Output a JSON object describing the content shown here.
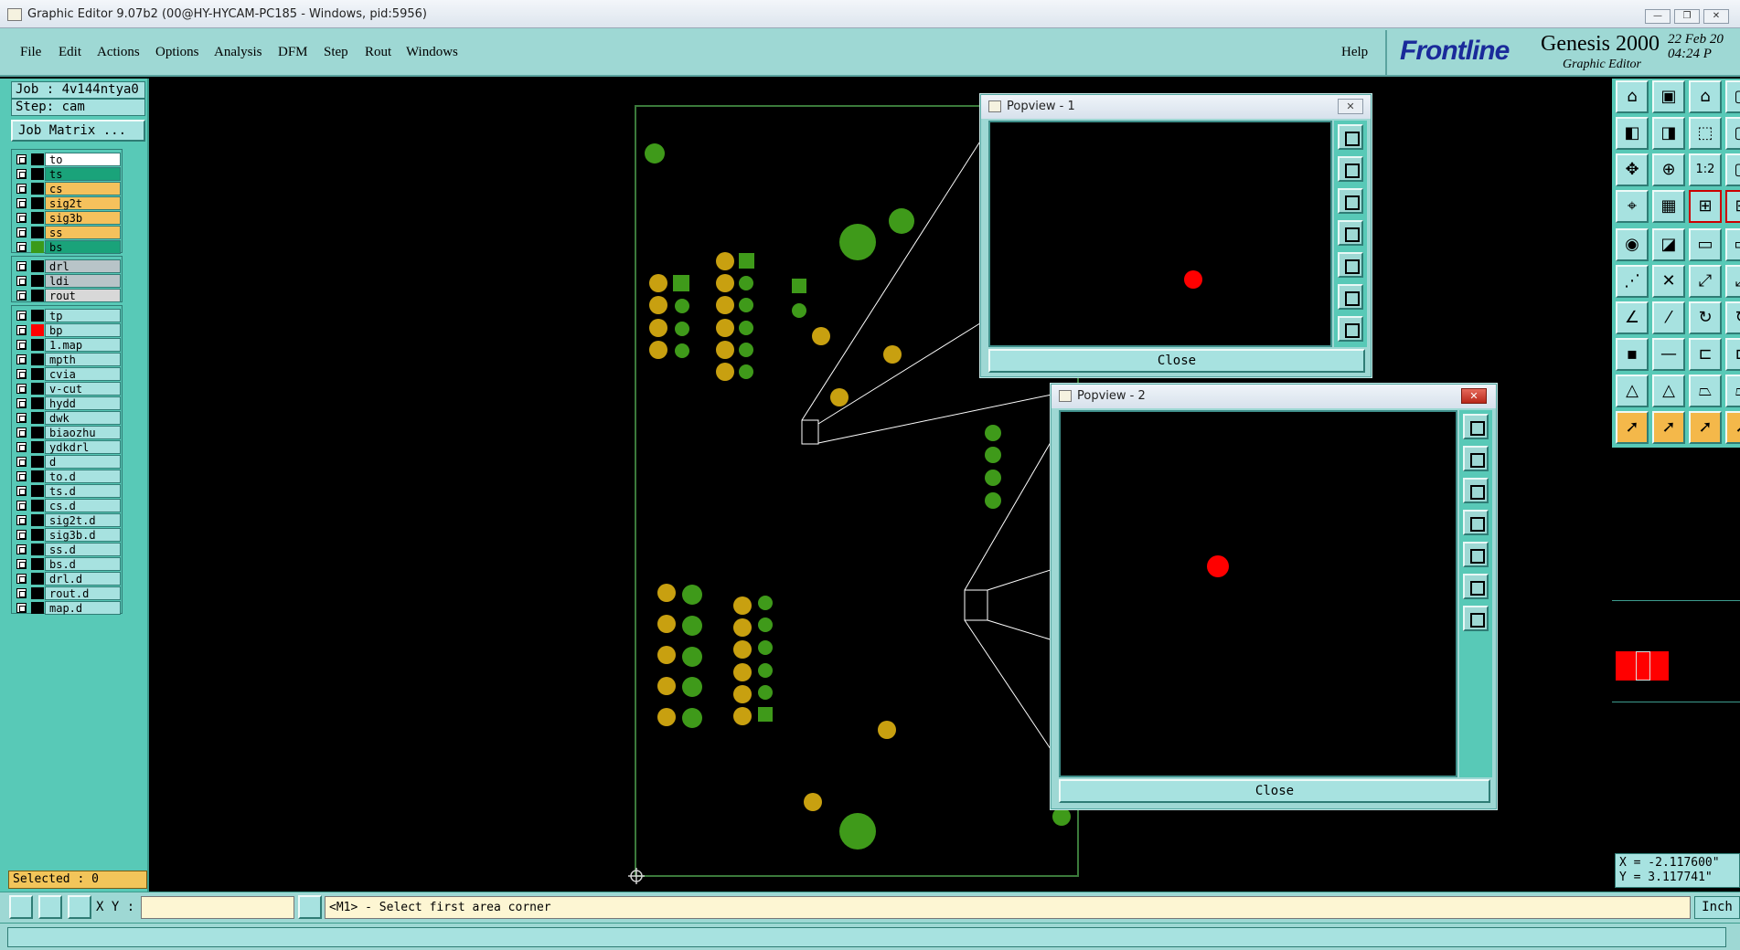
{
  "window": {
    "title": "Graphic Editor 9.07b2 (00@HY-HYCAM-PC185 - Windows, pid:5956)",
    "minimize": "—",
    "maximize": "❐",
    "close": "✕"
  },
  "menu": {
    "items": [
      "File",
      "Edit",
      "Actions",
      "Options",
      "Analysis",
      "DFM",
      "Step",
      "Rout",
      "Windows"
    ],
    "help": "Help"
  },
  "brand": {
    "logo": "Frontline",
    "product": "Genesis 2000",
    "subtitle": "Graphic Editor",
    "date": "22 Feb 20",
    "time": "04:24 P"
  },
  "job": {
    "job_label": "Job : 4v144ntya0",
    "step_label": "Step: cam",
    "matrix_button": "Job Matrix ..."
  },
  "layers": {
    "group1": [
      {
        "name": "to",
        "color": "#ffffff",
        "swatch": "#000000"
      },
      {
        "name": "ts",
        "color": "#1aa37a",
        "swatch": "#000000"
      },
      {
        "name": "cs",
        "color": "#f5c15c",
        "swatch": "#000000"
      },
      {
        "name": "sig2t",
        "color": "#f5c15c",
        "swatch": "#000000"
      },
      {
        "name": "sig3b",
        "color": "#f5c15c",
        "swatch": "#000000"
      },
      {
        "name": "ss",
        "color": "#f5c15c",
        "swatch": "#000000"
      },
      {
        "name": "bs",
        "color": "#1aa37a",
        "swatch": "#3a9a1a"
      }
    ],
    "group2": [
      {
        "name": "drl",
        "color": "#b8c4c8",
        "swatch": "#000000"
      },
      {
        "name": "ldi",
        "color": "#b8c4c8",
        "swatch": "#000000"
      },
      {
        "name": "rout",
        "color": "#d8d8d8",
        "swatch": "#000000"
      }
    ],
    "group3": [
      {
        "name": "tp",
        "color": "#a7e2e0",
        "swatch": "#000000"
      },
      {
        "name": "bp",
        "color": "#a7e2e0",
        "swatch": "#ff0000"
      },
      {
        "name": "1.map",
        "color": "#a7e2e0",
        "swatch": "#000000"
      },
      {
        "name": "mpth",
        "color": "#a7e2e0",
        "swatch": "#000000"
      },
      {
        "name": "cvia",
        "color": "#a7e2e0",
        "swatch": "#000000"
      },
      {
        "name": "v-cut",
        "color": "#a7e2e0",
        "swatch": "#000000"
      },
      {
        "name": "hydd",
        "color": "#a7e2e0",
        "swatch": "#000000"
      },
      {
        "name": "dwk",
        "color": "#a7e2e0",
        "swatch": "#000000"
      },
      {
        "name": "biaozhu",
        "color": "#a7e2e0",
        "swatch": "#000000"
      },
      {
        "name": "ydkdrl",
        "color": "#a7e2e0",
        "swatch": "#000000"
      },
      {
        "name": "d",
        "color": "#a7e2e0",
        "swatch": "#000000"
      },
      {
        "name": "to.d",
        "color": "#a7e2e0",
        "swatch": "#000000"
      },
      {
        "name": "ts.d",
        "color": "#a7e2e0",
        "swatch": "#000000"
      },
      {
        "name": "cs.d",
        "color": "#a7e2e0",
        "swatch": "#000000"
      },
      {
        "name": "sig2t.d",
        "color": "#a7e2e0",
        "swatch": "#000000"
      },
      {
        "name": "sig3b.d",
        "color": "#a7e2e0",
        "swatch": "#000000"
      },
      {
        "name": "ss.d",
        "color": "#a7e2e0",
        "swatch": "#000000"
      },
      {
        "name": "bs.d",
        "color": "#a7e2e0",
        "swatch": "#000000"
      },
      {
        "name": "drl.d",
        "color": "#a7e2e0",
        "swatch": "#000000"
      },
      {
        "name": "rout.d",
        "color": "#a7e2e0",
        "swatch": "#000000"
      },
      {
        "name": "map.d",
        "color": "#a7e2e0",
        "swatch": "#000000"
      }
    ]
  },
  "selected": "Selected : 0",
  "popview1": {
    "title": "Popview - 1",
    "close": "Close"
  },
  "popview2": {
    "title": "Popview - 2",
    "close": "Close"
  },
  "coords": {
    "x": "X = -2.117600\"",
    "y": "Y = 3.117741\""
  },
  "bottom": {
    "xy_label": "X Y :",
    "xy_value": "",
    "prompt": "<M1> - Select first area corner",
    "units": "Inch"
  },
  "colors": {
    "accent": "#9ed8d4",
    "panel": "#58c9b7",
    "pad_green": "#3f9a1a",
    "pad_gold": "#c8a010",
    "feature_red": "#ff0000"
  },
  "icons": {
    "toolbar_right": [
      "home-icon",
      "save-icon",
      "zoom-home-icon",
      "pan-icon",
      "zoom-window-icon",
      "zoom-fit-icon",
      "zoom-in-icon",
      "scale-1-2-icon",
      "measure-icon",
      "grid-icon",
      "snap-icon",
      "select-icon"
    ]
  }
}
